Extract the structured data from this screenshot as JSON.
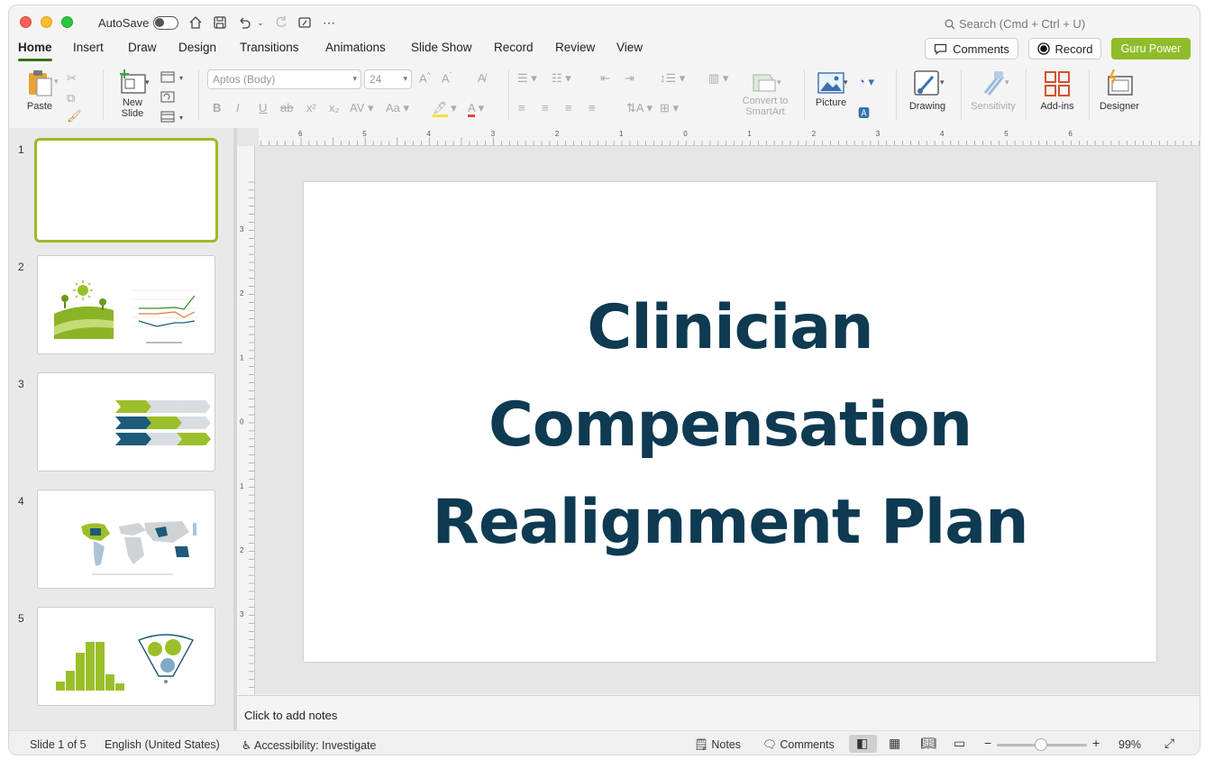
{
  "titlebar": {
    "autosave_label": "AutoSave",
    "search_placeholder": "Search (Cmd + Ctrl + U)"
  },
  "tabs": [
    "Home",
    "Insert",
    "Draw",
    "Design",
    "Transitions",
    "Animations",
    "Slide Show",
    "Record",
    "Review",
    "View"
  ],
  "active_tab": "Home",
  "header_buttons": {
    "comments": "Comments",
    "record": "Record",
    "guru": "Guru Power",
    "guru_color": "#8fbd2a"
  },
  "ribbon": {
    "paste": "Paste",
    "new_slide_1": "New",
    "new_slide_2": "Slide",
    "font_name": "Aptos (Body)",
    "font_size": "24",
    "convert_1": "Convert to",
    "convert_2": "SmartArt",
    "picture": "Picture",
    "drawing": "Drawing",
    "sensitivity": "Sensitivity",
    "addins": "Add-ins",
    "designer": "Designer"
  },
  "thumbnails": [
    "1",
    "2",
    "3",
    "4",
    "5"
  ],
  "selected_slide": 1,
  "ruler": {
    "h_labels": [
      "6",
      "5",
      "4",
      "3",
      "2",
      "1",
      "0",
      "1",
      "2",
      "3",
      "4",
      "5",
      "6"
    ],
    "v_labels": [
      "3",
      "2",
      "1",
      "0",
      "1",
      "2",
      "3"
    ]
  },
  "slide": {
    "title_lines": [
      "Clinician",
      "Compensation",
      "Realignment Plan"
    ],
    "title_color": "#0e3a52"
  },
  "notes_placeholder": "Click to add notes",
  "status": {
    "slide_counter": "Slide 1 of 5",
    "language": "English (United States)",
    "accessibility": "Accessibility: Investigate",
    "notes": "Notes",
    "comments": "Comments",
    "zoom": "99%"
  }
}
